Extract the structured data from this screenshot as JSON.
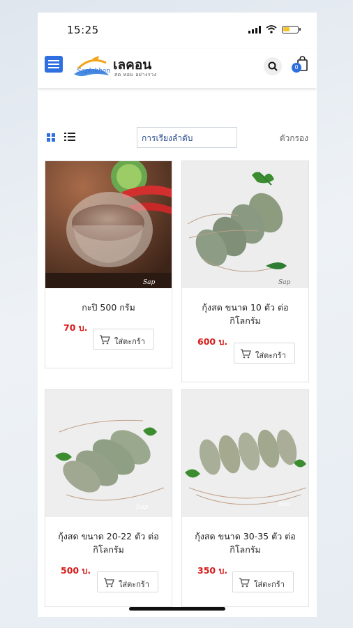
{
  "status_bar": {
    "time": "15:25"
  },
  "header": {
    "logo_mark_text": "Saplakhon",
    "logo_text": "เลคอน",
    "logo_sub": "สด หอม อย่างรวง",
    "cart_count": "0",
    "brand_color": "#2f6fdf"
  },
  "toolbar": {
    "sort_label": "การเรียงลำดับ",
    "filter_label": "ตัวกรอง"
  },
  "products": [
    {
      "title": "กะปิ 500 กรัม",
      "price": "70 บ.",
      "add_label": "ใส่ตะกร้า"
    },
    {
      "title": "กุ้งสด ขนาด 10 ตัว ต่อ กิโลกรัม",
      "price": "600 บ.",
      "add_label": "ใส่ตะกร้า"
    },
    {
      "title": "กุ้งสด ขนาด 20-22 ตัว ต่อ กิโลกรัม",
      "price": "500 บ.",
      "add_label": "ใส่ตะกร้า"
    },
    {
      "title": "กุ้งสด ขนาด 30-35 ตัว ต่อ กิโลกรัม",
      "price": "350 บ.",
      "add_label": "ใส่ตะกร้า"
    }
  ]
}
